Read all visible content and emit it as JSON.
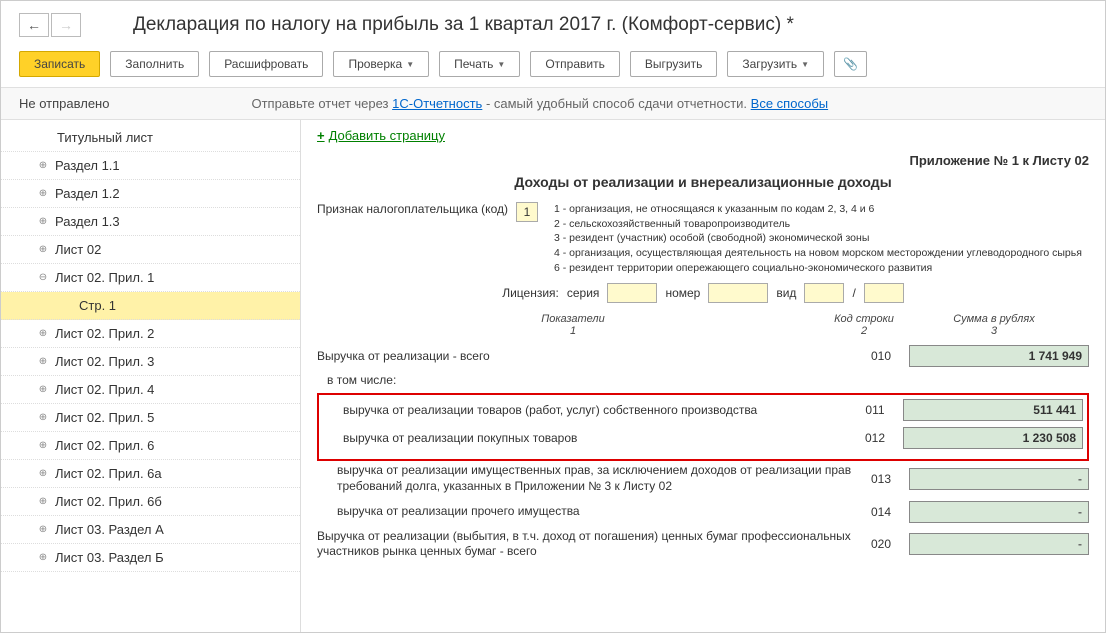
{
  "title": "Декларация по налогу на прибыль за 1 квартал 2017 г. (Комфорт-сервис) *",
  "toolbar": {
    "save": "Записать",
    "fill": "Заполнить",
    "decode": "Расшифровать",
    "check": "Проверка",
    "print": "Печать",
    "send": "Отправить",
    "upload": "Выгрузить",
    "download": "Загрузить"
  },
  "status": {
    "state": "Не отправлено",
    "hint_prefix": "Отправьте отчет через ",
    "hint_link": "1С-Отчетность",
    "hint_suffix": " - самый удобный способ сдачи отчетности. ",
    "all_ways": "Все способы"
  },
  "tree": {
    "items": [
      "Титульный лист",
      "Раздел 1.1",
      "Раздел 1.2",
      "Раздел 1.3",
      "Лист 02",
      "Лист 02. Прил. 1",
      "Стр. 1",
      "Лист 02. Прил. 2",
      "Лист 02. Прил. 3",
      "Лист 02. Прил. 4",
      "Лист 02. Прил. 5",
      "Лист 02. Прил. 6",
      "Лист 02. Прил. 6а",
      "Лист 02. Прил. 6б",
      "Лист 03. Раздел А",
      "Лист 03. Раздел Б"
    ]
  },
  "main": {
    "add_page": "Добавить страницу",
    "annex": "Приложение № 1 к Листу 02",
    "section_title": "Доходы от реализации и внереализационные доходы",
    "taxpayer_label": "Признак налогоплательщика (код)",
    "taxpayer_code": "1",
    "notes": [
      "1 - организация, не относящаяся к указанным по кодам 2, 3, 4 и 6",
      "2 - сельскохозяйственный товаропроизводитель",
      "3 - резидент (участник) особой (свободной) экономической зоны",
      "4 - организация, осуществляющая деятельность на новом морском месторождении углеводородного сырья",
      "6 - резидент территории опережающего социально-экономического развития"
    ],
    "license": {
      "label": "Лицензия:",
      "series": "серия",
      "number": "номер",
      "type": "вид",
      "slash": "/"
    },
    "cols": {
      "c1": "Показатели",
      "c1n": "1",
      "c2": "Код строки",
      "c2n": "2",
      "c3": "Сумма в рублях",
      "c3n": "3"
    },
    "rows": {
      "r010_label": "Выручка от реализации - всего",
      "r010_code": "010",
      "r010_value": "1 741 949",
      "sub_label": "в том числе:",
      "r011_label": "выручка от реализации товаров (работ, услуг) собственного производства",
      "r011_code": "011",
      "r011_value": "511 441",
      "r012_label": "выручка от реализации покупных товаров",
      "r012_code": "012",
      "r012_value": "1 230 508",
      "r013_label": "выручка от реализации имущественных прав, за исключением доходов от реализации прав требований долга, указанных в Приложении № 3 к Листу 02",
      "r013_code": "013",
      "r014_label": "выручка от реализации прочего имущества",
      "r014_code": "014",
      "r020_label": "Выручка от реализации (выбытия, в т.ч. доход от погашения) ценных бумаг профессиональных участников рынка ценных бумаг - всего",
      "r020_code": "020"
    }
  }
}
